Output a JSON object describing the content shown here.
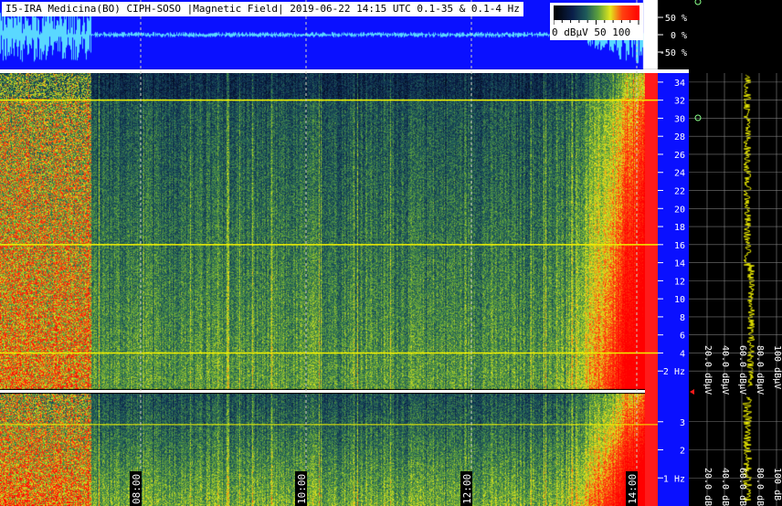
{
  "title": "I5-IRA Medicina(BO) CIPH-SOSO |Magnetic Field| 2019-06-22 14:15 UTC 0.1-35 & 0.1-4 Hz",
  "colorbar": {
    "label": "0 dBµV 50   100",
    "min": 0,
    "mid": 50,
    "max": 100,
    "unit": "dBµV"
  },
  "colors": {
    "waveform_bg": "#0a10ff",
    "waveform_trace": "#5ad8ff",
    "line_trace": "#f0f000",
    "grid": "#d0d0c0",
    "separator": "#ffffff",
    "accent_red": "#ff1a1a"
  },
  "chart_data": [
    {
      "type": "line",
      "name": "amplitude-waveform",
      "ylabel": "",
      "yticks": [
        "50 %",
        "0 %",
        "-50 %"
      ],
      "yvalues": [
        50,
        0,
        -50
      ],
      "ylim": [
        -100,
        100
      ]
    },
    {
      "type": "heatmap",
      "name": "spectrogram-0.1-35-Hz",
      "yticks": [
        "34",
        "32",
        "30",
        "28",
        "26",
        "24",
        "22",
        "20",
        "18",
        "16",
        "14",
        "12",
        "10",
        "8",
        "6",
        "4",
        "2 Hz"
      ],
      "yvalues": [
        34,
        32,
        30,
        28,
        26,
        24,
        22,
        20,
        18,
        16,
        14,
        12,
        10,
        8,
        6,
        4,
        2
      ],
      "ylim": [
        0,
        35
      ],
      "horizontal_lines_hz": [
        32,
        16,
        4
      ],
      "colorscale": "dBµV 0-100"
    },
    {
      "type": "heatmap",
      "name": "spectrogram-0.1-4-Hz",
      "yticks": [
        "3",
        "2",
        "1 Hz"
      ],
      "yvalues": [
        3,
        2,
        1
      ],
      "ylim": [
        0,
        4
      ],
      "horizontal_lines_hz": [
        2.9
      ],
      "colorscale": "dBµV 0-100"
    },
    {
      "type": "line",
      "name": "average-spectrum",
      "xticks": [
        "20.0 dBµV",
        "40.0 dBµV",
        "60.0 dBµV",
        "80.0 dBµV",
        "100 dBµV"
      ],
      "xvalues": [
        20,
        40,
        60,
        80,
        100
      ]
    },
    {
      "type": "line",
      "name": "average-spectrum-low",
      "xticks": [
        "20.0 dB",
        "40.0 dB",
        "60.0 dB",
        "80.0 dB",
        "100 dB"
      ],
      "xvalues": [
        20,
        40,
        60,
        80,
        100
      ]
    }
  ],
  "time_axis": {
    "labels": [
      "08:00",
      "10:00",
      "12:00",
      "14:00"
    ]
  }
}
